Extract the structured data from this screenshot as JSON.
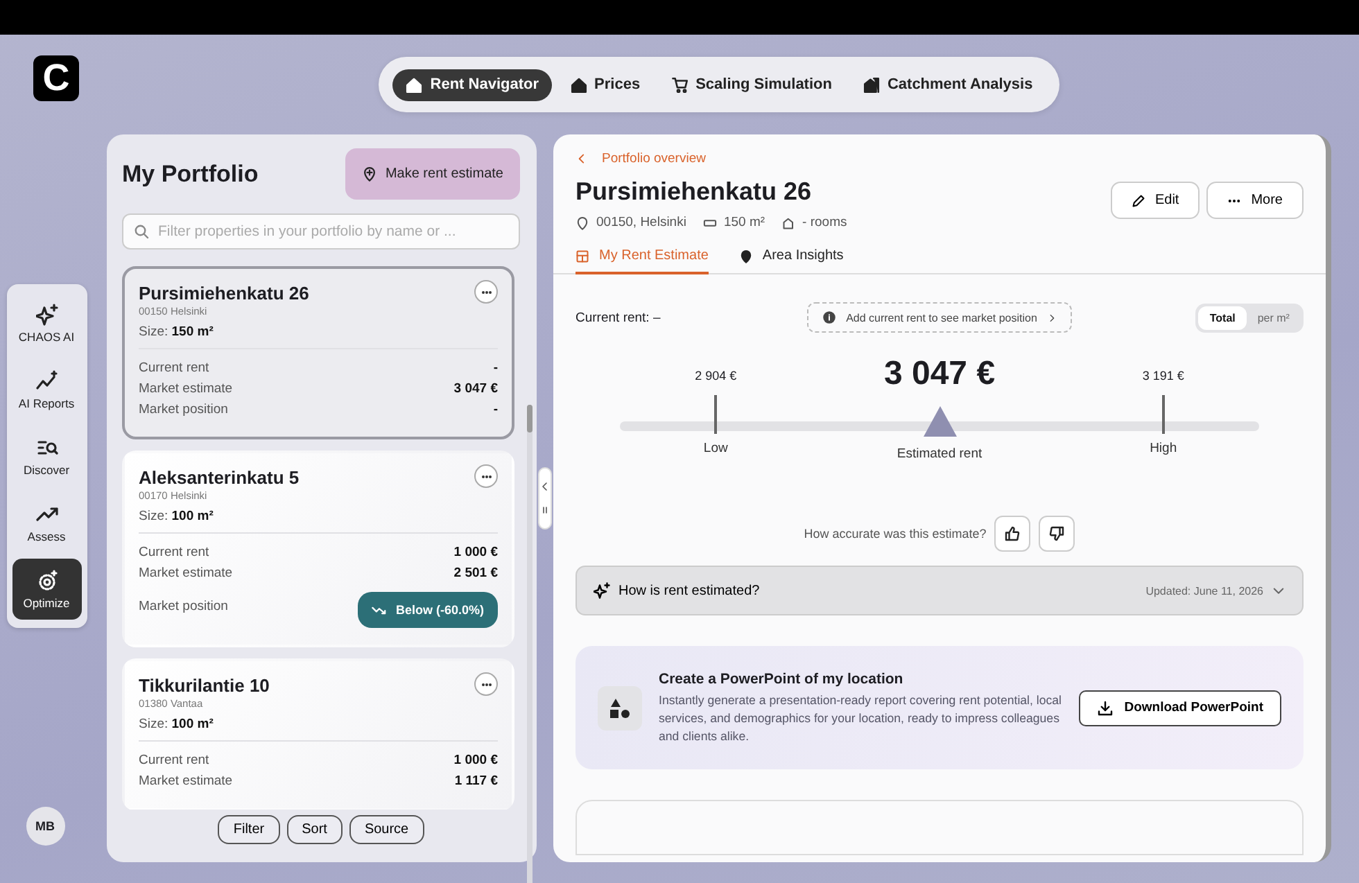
{
  "logo": {
    "letter": "C"
  },
  "nav": [
    {
      "label": "Rent Navigator",
      "selected": true
    },
    {
      "label": "Prices",
      "selected": false
    },
    {
      "label": "Scaling Simulation",
      "selected": false
    },
    {
      "label": "Catchment Analysis",
      "selected": false
    }
  ],
  "rail": [
    {
      "label": "CHAOS AI",
      "selected": false
    },
    {
      "label": "AI Reports",
      "selected": false
    },
    {
      "label": "Discover",
      "selected": false
    },
    {
      "label": "Assess",
      "selected": false
    },
    {
      "label": "Optimize",
      "selected": true
    }
  ],
  "user": {
    "initials": "MB"
  },
  "portfolio": {
    "title": "My Portfolio",
    "action": "Make rent estimate",
    "search": {
      "placeholder": "Filter properties in your portfolio by name or ..."
    },
    "properties": [
      {
        "name": "Pursimiehenkatu 26",
        "location": "00150 Helsinki",
        "size_label": "Size:",
        "size": "150 m²",
        "selected": true,
        "rows": [
          {
            "label": "Current rent",
            "value": "-"
          },
          {
            "label": "Market estimate",
            "value": "3 047 €"
          },
          {
            "label": "Market position",
            "value": "-",
            "kind": "text"
          }
        ]
      },
      {
        "name": "Aleksanterinkatu 5",
        "location": "00170 Helsinki",
        "size_label": "Size:",
        "size": "100 m²",
        "selected": false,
        "rows": [
          {
            "label": "Current rent",
            "value": "1 000 €"
          },
          {
            "label": "Market estimate",
            "value": "2 501 €"
          },
          {
            "label": "Market position",
            "value": "Below (-60.0%)",
            "kind": "badge"
          }
        ]
      },
      {
        "name": "Tikkurilantie 10",
        "location": "01380 Vantaa",
        "size_label": "Size:",
        "size": "100 m²",
        "selected": false,
        "rows": [
          {
            "label": "Current rent",
            "value": "1 000 €"
          },
          {
            "label": "Market estimate",
            "value": "1 117 €"
          }
        ]
      }
    ],
    "buttons": [
      "Filter",
      "Sort",
      "Source"
    ]
  },
  "detail": {
    "back": "Portfolio overview",
    "title": "Pursimiehenkatu 26",
    "meta": [
      {
        "kind": "location",
        "text": "00150, Helsinki"
      },
      {
        "kind": "area",
        "text": "150 m²"
      },
      {
        "kind": "rooms",
        "text": "- rooms"
      }
    ],
    "actions": [
      {
        "kind": "edit",
        "label": "Edit"
      },
      {
        "kind": "more",
        "label": "More"
      }
    ],
    "tabs": [
      {
        "label": "My Rent Estimate",
        "selected": true
      },
      {
        "label": "Area Insights",
        "selected": false
      }
    ],
    "current_rent": "Current rent: –",
    "hint": "Add current rent to see market position",
    "units": [
      {
        "label": "Total",
        "selected": true
      },
      {
        "label": "per m²",
        "selected": false
      }
    ],
    "estimate": {
      "value": "3 047 €",
      "label": "Estimated rent",
      "level": 0.5
    },
    "low": {
      "value": "2 904 €",
      "label": "Low",
      "level": 0.15
    },
    "high": {
      "value": "3 191 €",
      "label": "High",
      "level": 0.85
    },
    "feedback": "How accurate was this estimate?",
    "accordion": {
      "title": "How is rent estimated?",
      "updated": "Updated: June 11, 2026",
      "expanded": false
    },
    "promo": {
      "title": "Create a PowerPoint of my location",
      "text": "Instantly generate a presentation-ready report covering rent potential, local services, and demographics for your location, ready to impress colleagues and clients alike.",
      "button": "Download PowerPoint"
    }
  }
}
